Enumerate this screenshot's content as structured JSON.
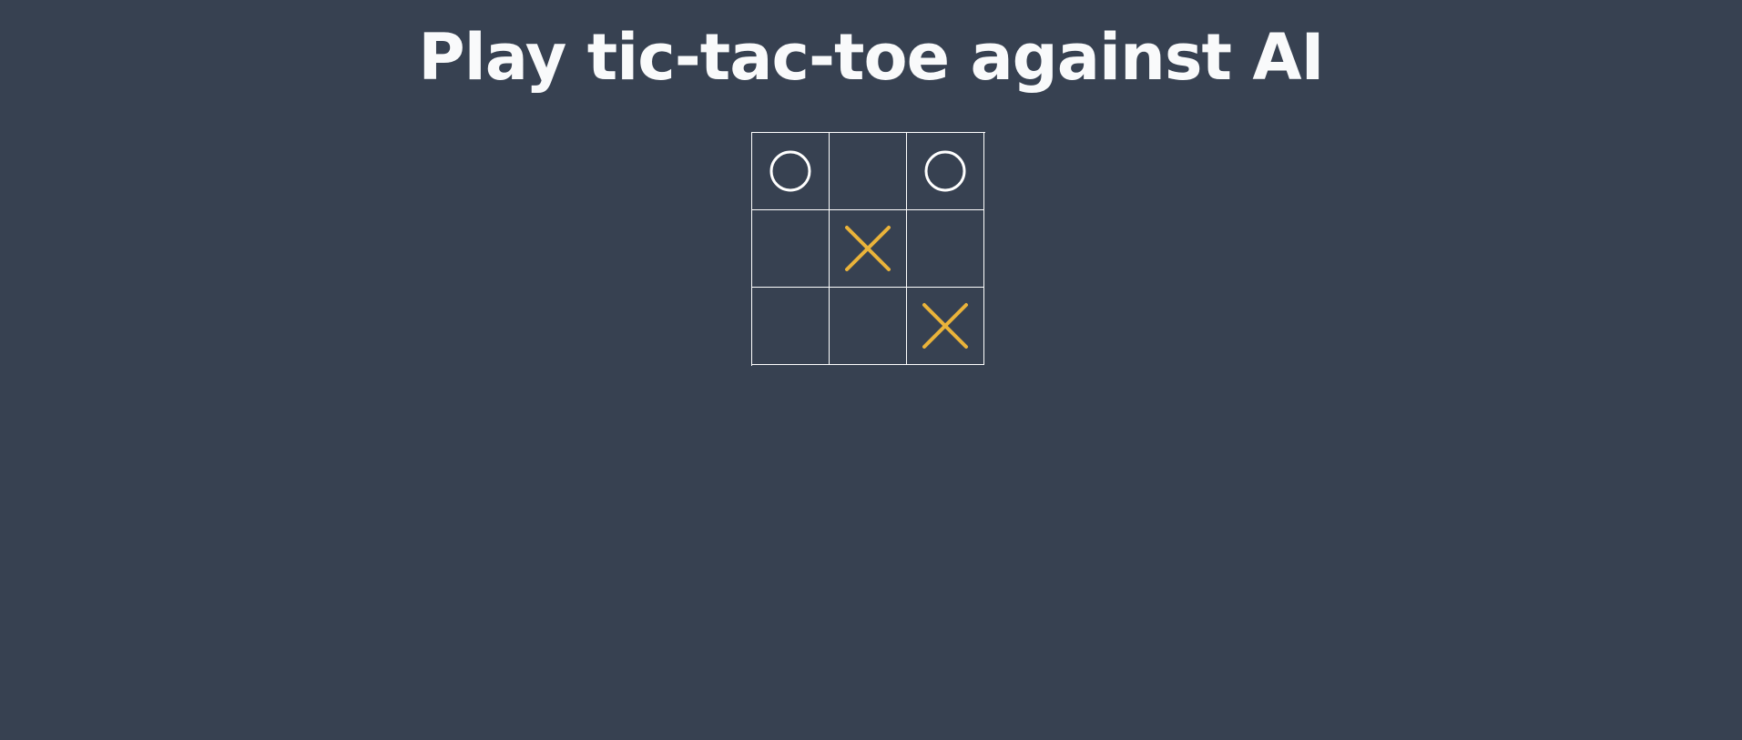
{
  "title": "Play tic-tac-toe against AI",
  "colors": {
    "background": "#374151",
    "grid": "#ffffff",
    "o_mark": "#ffffff",
    "x_mark": "#eab33a"
  },
  "board": {
    "cells": [
      "O",
      "",
      "O",
      "",
      "X",
      "",
      "",
      "",
      "X"
    ]
  }
}
